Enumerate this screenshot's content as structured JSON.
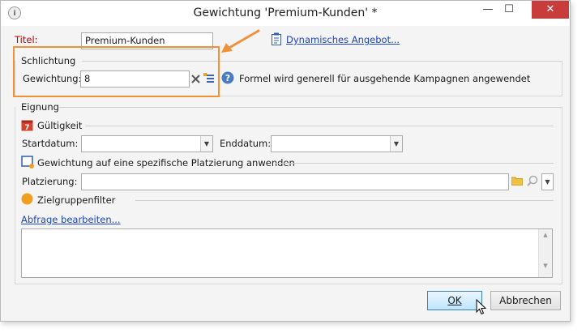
{
  "window": {
    "title": "Gewichtung 'Premium-Kunden' *",
    "app_icon": "i",
    "min_glyph": "—",
    "max_glyph": "☐",
    "close_glyph": "✕"
  },
  "form": {
    "title_label": "Titel:",
    "title_value": "Premium-Kunden",
    "offer_link": "Dynamisches Angebot...",
    "arbitration": {
      "section_label": "Schlichtung",
      "weight_label": "Gewichtung:",
      "weight_value": "8",
      "info_text": "Formel wird generell für ausgehende Kampagnen angewendet"
    },
    "eligibility": {
      "section_label": "Eignung",
      "validity": {
        "label": "Gültigkeit",
        "calendar_day": "7",
        "start_label": "Startdatum:",
        "start_value": "",
        "end_label": "Enddatum:",
        "end_value": ""
      },
      "placement": {
        "apply_label": "Gewichtung auf eine spezifische Platzierung anwenden",
        "placement_label": "Platzierung:",
        "placement_value": ""
      },
      "audience": {
        "label": "Zielgruppenfilter",
        "edit_query_link": "Abfrage bearbeiten...",
        "query_text": ""
      }
    }
  },
  "buttons": {
    "ok": "OK",
    "cancel": "Abbrechen"
  },
  "colors": {
    "highlight": "#f0913a",
    "required_label": "#c00000",
    "link": "#1c46b8",
    "audience_dot": "#f0a020",
    "calendar": "#d9402c"
  }
}
